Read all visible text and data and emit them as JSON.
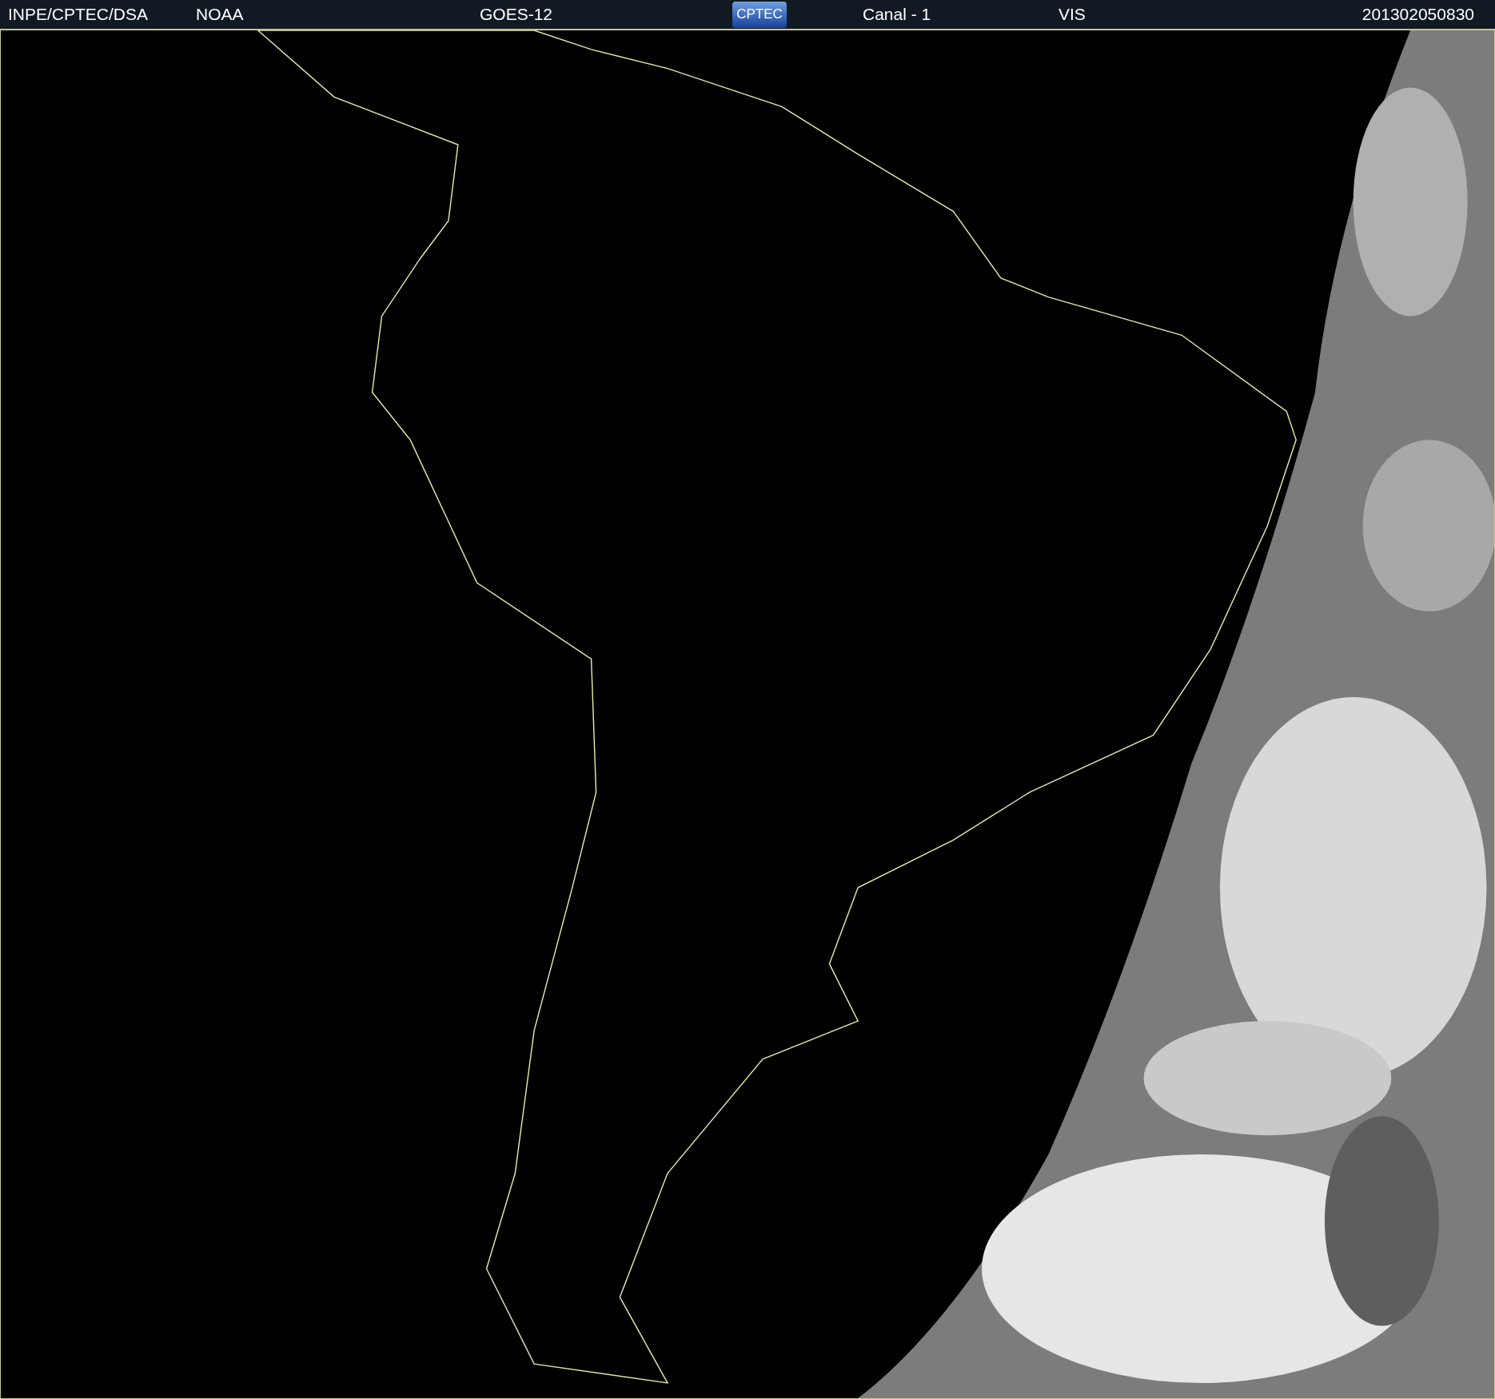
{
  "header": {
    "source": "INPE/CPTEC/DSA",
    "agency": "NOAA",
    "satellite": "GOES-12",
    "logo": "CPTEC",
    "channel": "Canal - 1",
    "band": "VIS",
    "timestamp": "201302050830"
  }
}
